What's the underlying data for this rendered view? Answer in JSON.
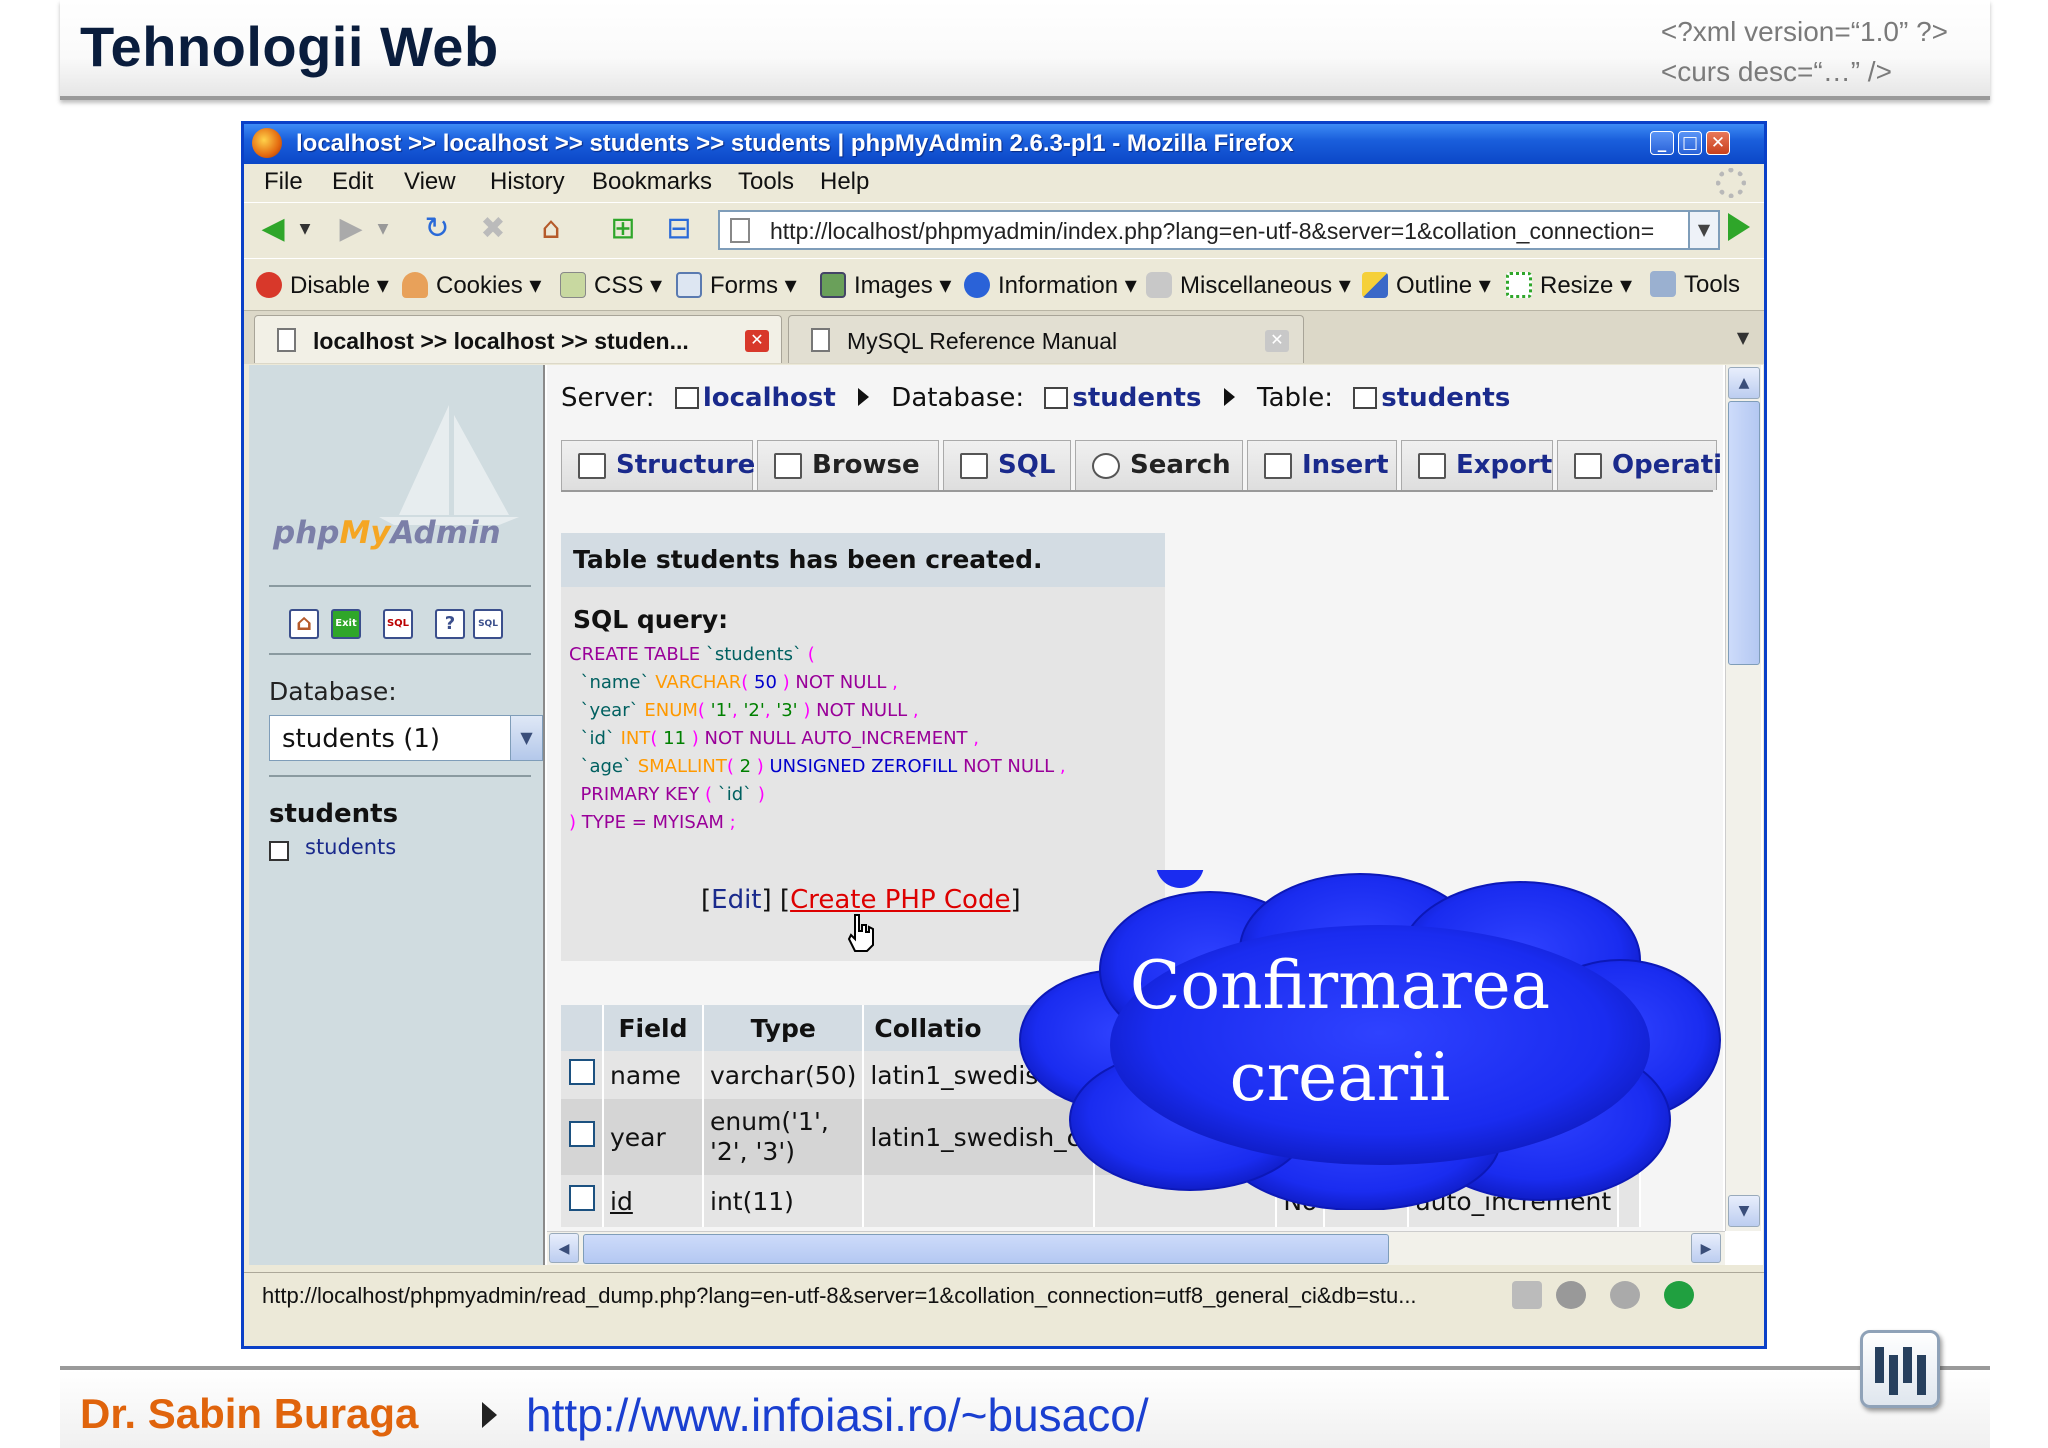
{
  "slide": {
    "title": "Tehnologii Web",
    "xml_line1": "<?xml version=“1.0” ?>",
    "xml_line2": "<curs desc=“…” />",
    "author": "Dr. Sabin Buraga",
    "url": "http://www.infoiasi.ro/~busaco/"
  },
  "browser": {
    "title": "localhost >> localhost >> students  >> students | phpMyAdmin 2.6.3-pl1 - Mozilla Firefox",
    "menu": [
      "File",
      "Edit",
      "View",
      "History",
      "Bookmarks",
      "Tools",
      "Help"
    ],
    "address": "http://localhost/phpmyadmin/index.php?lang=en-utf-8&server=1&collation_connection=",
    "webdev_toolbar": [
      "Disable",
      "Cookies",
      "CSS",
      "Forms",
      "Images",
      "Information",
      "Miscellaneous",
      "Outline",
      "Resize",
      "Tools"
    ],
    "tabs": [
      {
        "label": "localhost >> localhost >> studen...",
        "active": true
      },
      {
        "label": "MySQL Reference Manual",
        "active": false
      }
    ],
    "status": "http://localhost/phpmyadmin/read_dump.php?lang=en-utf-8&server=1&collation_connection=utf8_general_ci&db=stu..."
  },
  "left_frame": {
    "logo_php": "php",
    "logo_my": "My",
    "logo_admin": "Admin",
    "database_label": "Database:",
    "database_value": "students (1)",
    "db_name": "students",
    "table_link": "students"
  },
  "breadcrumb": {
    "server_label": "Server:",
    "server": "localhost",
    "database_label": "Database:",
    "database": "students",
    "table_label": "Table:",
    "table": "students"
  },
  "pma_tabs": [
    "Structure",
    "Browse",
    "SQL",
    "Search",
    "Insert",
    "Export",
    "Operatio"
  ],
  "message": {
    "title": "Table students has been created.",
    "sql_label": "SQL query:",
    "edit": "Edit",
    "create_php": "Create PHP Code"
  },
  "sql_lines": [
    "CREATE TABLE `students` (",
    "  `name` VARCHAR( 50 ) NOT NULL ,",
    "  `year` ENUM( '1', '2', '3' ) NOT NULL ,",
    "  `id` INT( 11 ) NOT NULL AUTO_INCREMENT ,",
    "  `age` SMALLINT( 2 ) UNSIGNED ZEROFILL NOT NULL ,",
    "  PRIMARY KEY ( `id` )",
    ") TYPE = MYISAM ;"
  ],
  "fields_table": {
    "headers": [
      "Field",
      "Type",
      "Collatio"
    ],
    "rows": [
      {
        "field": "name",
        "type": "varchar(50)",
        "collation": "latin1_swedis",
        "null": "",
        "extra": ""
      },
      {
        "field": "year",
        "type_line1": "enum('1',",
        "type_line2": "'2', '3')",
        "collation": "latin1_swedish_ci",
        "null": "",
        "extra": ""
      },
      {
        "field": "id",
        "type": "int(11)",
        "collation": "",
        "null": "No",
        "extra": "auto_increment"
      }
    ]
  },
  "callout": {
    "line1": "Confirmarea",
    "line2": "crearii",
    "color": "#1a2cf0"
  }
}
